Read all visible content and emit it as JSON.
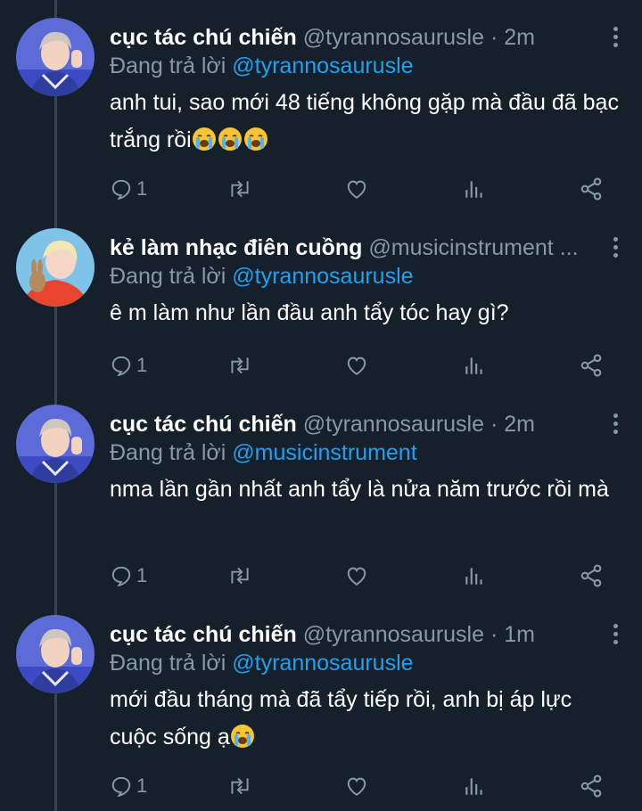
{
  "colors": {
    "background": "#15202b",
    "text": "#ffffff",
    "muted": "#8899a6",
    "accent": "#1da1f2",
    "thread_line": "#38444d"
  },
  "tweets": [
    {
      "name": "cục tác chú chiến",
      "handle": "@tyrannosaurusle",
      "dot": "·",
      "time": "2m",
      "reply_prefix": "Đang trả lời ",
      "reply_to": "@tyrannosaurusle",
      "text": "anh tui, sao mới 48 tiếng không gặp mà đầu đã bạc trắng rồi",
      "emoji": [
        "loudly-crying-face",
        "loudly-crying-face",
        "loudly-crying-face"
      ],
      "reply_count": "1"
    },
    {
      "name": "kẻ làm nhạc điên cuồng",
      "handle": "@musicinstrument ...",
      "dot": "",
      "time": "",
      "reply_prefix": "Đang trả lời ",
      "reply_to": "@tyrannosaurusle",
      "text": "ê m làm như lần đầu anh tẩy tóc hay gì?",
      "emoji": [],
      "reply_count": "1"
    },
    {
      "name": "cục tác chú chiến",
      "handle": "@tyrannosaurusle",
      "dot": "·",
      "time": "2m",
      "reply_prefix": "Đang trả lời ",
      "reply_to": "@musicinstrument",
      "text": "nma lần gần nhất anh tẩy là nửa năm trước rồi mà",
      "emoji": [],
      "reply_count": "1"
    },
    {
      "name": "cục tác chú chiến",
      "handle": "@tyrannosaurusle",
      "dot": "·",
      "time": "1m",
      "reply_prefix": "Đang trả lời ",
      "reply_to": "@tyrannosaurusle",
      "text": "mới đầu tháng mà đã tẩy tiếp rồi, anh bị áp lực cuộc sống ạ",
      "emoji": [
        "loudly-crying-face"
      ],
      "reply_count": "1"
    }
  ],
  "icons": {
    "reply": "reply-icon",
    "retweet": "retweet-icon",
    "like": "heart-icon",
    "analytics": "analytics-icon",
    "share": "share-icon",
    "more": "more-vertical-icon"
  }
}
